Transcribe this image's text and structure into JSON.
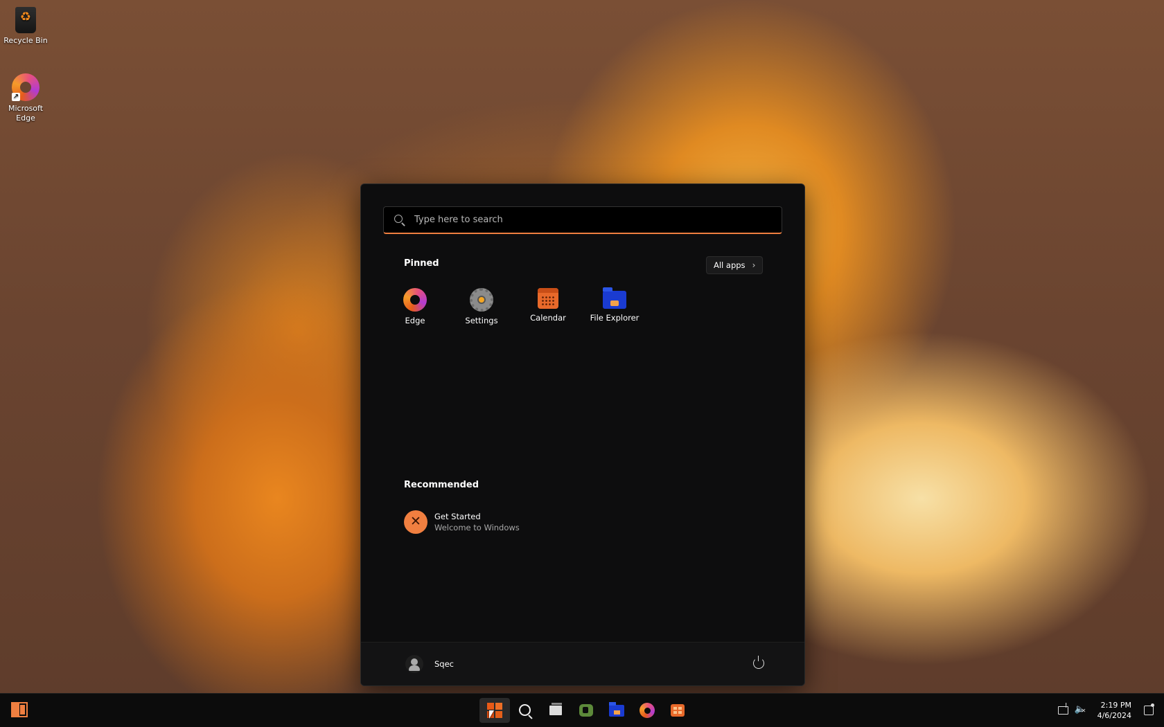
{
  "desktop": {
    "icons": [
      {
        "label": "Recycle Bin",
        "icon": "recycle-bin-icon"
      },
      {
        "label": "Microsoft Edge",
        "icon": "edge-icon"
      }
    ]
  },
  "start_menu": {
    "search": {
      "placeholder": "Type here to search"
    },
    "pinned_title": "Pinned",
    "all_apps_label": "All apps",
    "pinned_apps": [
      {
        "label": "Edge",
        "icon": "edge-icon"
      },
      {
        "label": "Settings",
        "icon": "settings-gear-icon"
      },
      {
        "label": "Calendar",
        "icon": "calendar-icon"
      },
      {
        "label": "File Explorer",
        "icon": "folder-icon"
      }
    ],
    "recommended_title": "Recommended",
    "recommended": [
      {
        "title": "Get Started",
        "subtitle": "Welcome to Windows",
        "icon": "get-started-icon"
      }
    ],
    "user": {
      "name": "Sqec"
    }
  },
  "taskbar": {
    "apps": [
      "start",
      "search",
      "task-view",
      "chat",
      "file-explorer",
      "edge",
      "store"
    ],
    "clock": {
      "time": "2:19 PM",
      "date": "4/6/2024"
    }
  },
  "colors": {
    "accent": "#f07f40",
    "menu_bg": "#0d0d0e",
    "taskbar_bg": "#0c0c0c"
  }
}
